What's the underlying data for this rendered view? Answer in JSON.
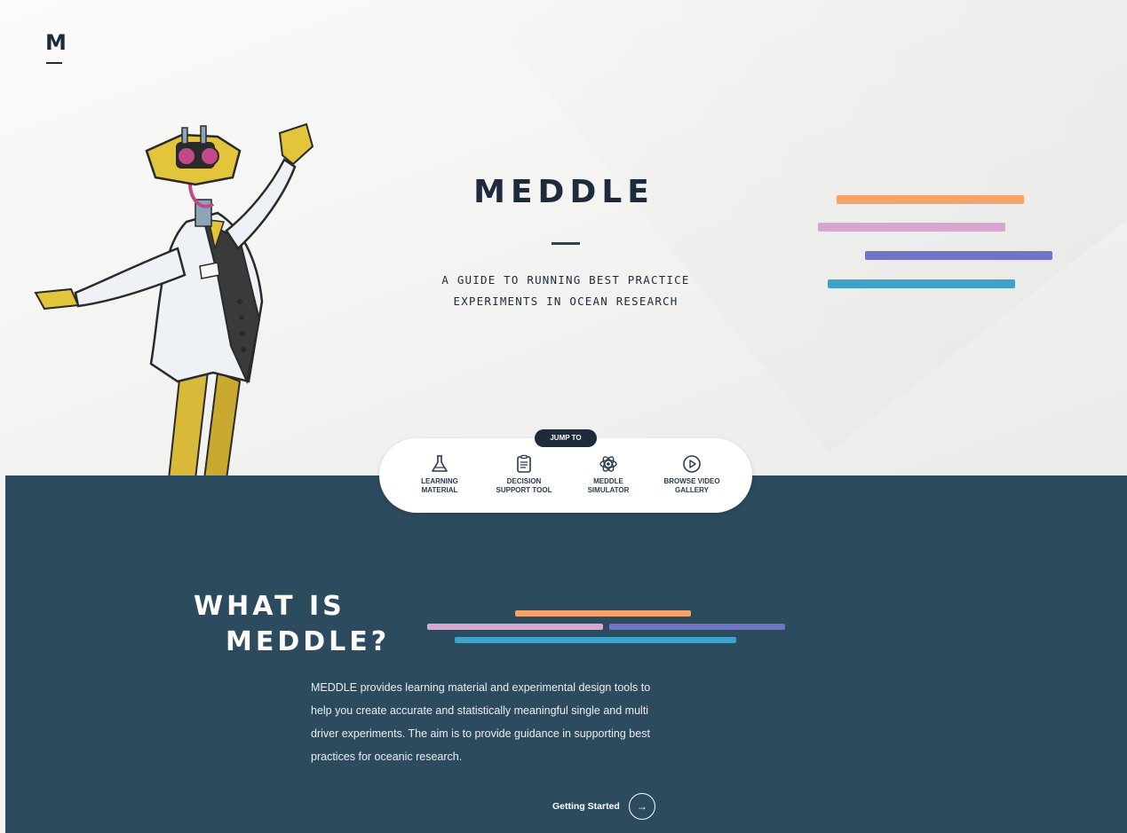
{
  "brand": {
    "logo_letter": "M",
    "title": "MEDDLE",
    "subtitle_line1": "A GUIDE TO RUNNING BEST PRACTICE",
    "subtitle_line2": "EXPERIMENTS IN OCEAN RESEARCH"
  },
  "colors": {
    "navy": "#1d2b3a",
    "section_bg": "#2d4b5e",
    "orange": "#f2a46a",
    "pink": "#d8a6cf",
    "purple": "#6f74c6",
    "teal": "#3fa2c8"
  },
  "jump_to": {
    "badge": "JUMP TO",
    "items": [
      {
        "label": "LEARNING\nMATERIAL",
        "icon": "flask-icon"
      },
      {
        "label": "DECISION\nSUPPORT TOOL",
        "icon": "clipboard-icon"
      },
      {
        "label": "MEDDLE\nSIMULATOR",
        "icon": "atom-icon"
      },
      {
        "label": "BROWSE VIDEO\nGALLERY",
        "icon": "play-circle-icon"
      }
    ]
  },
  "section": {
    "title_line1": "WHAT IS",
    "title_line2": "MEDDLE?",
    "body": "MEDDLE provides learning material and experimental design tools to help you create accurate and statistically meaningful single and multi driver experiments. The aim is to provide guidance in supporting best practices for oceanic research.",
    "cta_label": "Getting Started",
    "cta_icon": "arrow-right-icon"
  }
}
